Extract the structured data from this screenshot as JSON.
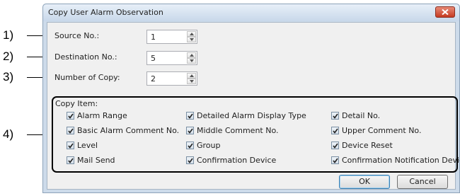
{
  "callouts": [
    "1)",
    "2)",
    "3)",
    "4)"
  ],
  "dialog": {
    "title": "Copy User Alarm Observation",
    "fields": [
      {
        "label": "Source No.:",
        "value": "1"
      },
      {
        "label": "Destination No.:",
        "value": "5"
      },
      {
        "label": "Number of Copy:",
        "value": "2"
      }
    ],
    "copy_item_label": "Copy Item:",
    "checkboxes": [
      {
        "label": "Alarm Range",
        "checked": true
      },
      {
        "label": "Detailed Alarm Display Type",
        "checked": true
      },
      {
        "label": "Detail No.",
        "checked": true
      },
      {
        "label": "Basic Alarm Comment No.",
        "checked": true
      },
      {
        "label": "Middle Comment No.",
        "checked": true
      },
      {
        "label": "Upper Comment No.",
        "checked": true
      },
      {
        "label": "Level",
        "checked": true
      },
      {
        "label": "Group",
        "checked": true
      },
      {
        "label": "Device Reset",
        "checked": true
      },
      {
        "label": "Mail Send",
        "checked": true
      },
      {
        "label": "Confirmation Device",
        "checked": true
      },
      {
        "label": "Confirmation Notification Device",
        "checked": true
      }
    ],
    "buttons": {
      "ok": "OK",
      "cancel": "Cancel"
    }
  },
  "colors": {
    "accent": "#3c7fb1",
    "close": "#c53b22",
    "frame": "#cddbea"
  }
}
